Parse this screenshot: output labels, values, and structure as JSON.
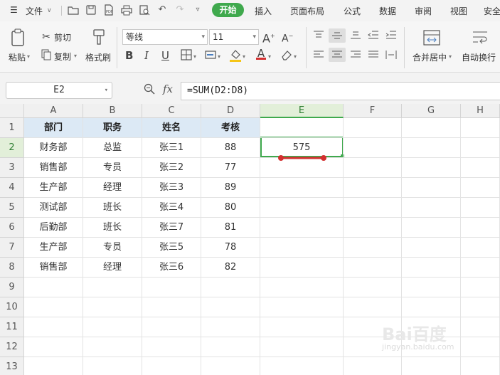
{
  "menubar": {
    "hamburger": "☰",
    "file": "文件",
    "tabs": [
      "开始",
      "插入",
      "页面布局",
      "公式",
      "数据",
      "审阅",
      "视图",
      "安全"
    ]
  },
  "ribbon": {
    "paste": "粘贴",
    "cut": "剪切",
    "copy": "复制",
    "format_painter": "格式刷",
    "font_name": "等线",
    "font_size": "11",
    "merge_center": "合并居中",
    "wrap_text": "自动换行"
  },
  "formula_bar": {
    "name_box": "E2",
    "fx": "fx",
    "formula": "=SUM(D2:D8)"
  },
  "sheet": {
    "columns": [
      "A",
      "B",
      "C",
      "D",
      "E",
      "F",
      "G",
      "H"
    ],
    "rows": [
      "1",
      "2",
      "3",
      "4",
      "5",
      "6",
      "7",
      "8",
      "9",
      "10",
      "11",
      "12",
      "13"
    ],
    "selected_column": "E",
    "selected_row": "2",
    "header_row": [
      "部门",
      "职务",
      "姓名",
      "考核"
    ],
    "data": [
      [
        "财务部",
        "总监",
        "张三1",
        "88",
        "575"
      ],
      [
        "销售部",
        "专员",
        "张三2",
        "77",
        ""
      ],
      [
        "生产部",
        "经理",
        "张三3",
        "89",
        ""
      ],
      [
        "测试部",
        "班长",
        "张三4",
        "80",
        ""
      ],
      [
        "后勤部",
        "班长",
        "张三7",
        "81",
        ""
      ],
      [
        "生产部",
        "专员",
        "张三5",
        "78",
        ""
      ],
      [
        "销售部",
        "经理",
        "张三6",
        "82",
        ""
      ]
    ]
  },
  "watermark": {
    "brand": "Bai百度",
    "sub": "jingyan.baidu.com"
  },
  "colors": {
    "accent": "#3fa94d",
    "header_fill": "#dce9f5",
    "annotation": "#d32f2f"
  }
}
